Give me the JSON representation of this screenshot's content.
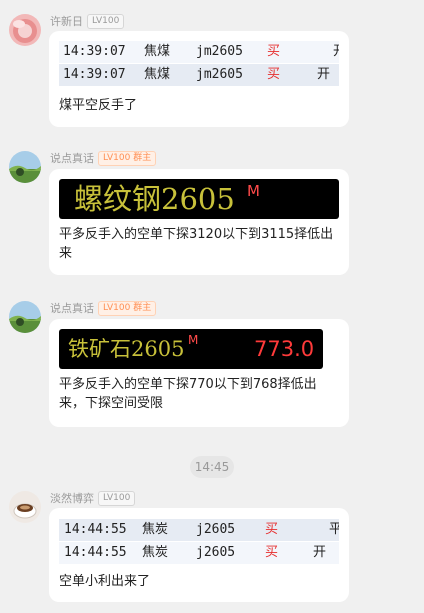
{
  "messages": [
    {
      "sender": "许新日",
      "level": "LV100",
      "table": {
        "rows": [
          {
            "time": "14:39:07",
            "name": "焦煤",
            "code": "jm2605",
            "side": "买",
            "action": "开"
          },
          {
            "time": "14:39:07",
            "name": "焦煤",
            "code": "jm2605",
            "side": "买",
            "action": "开"
          }
        ]
      },
      "text": "煤平空反手了"
    },
    {
      "sender": "说点真话",
      "level": "LV100",
      "role": "群主",
      "quote": {
        "name": "螺纹钢2605",
        "mark": "M"
      },
      "text": "平多反手入的空单下探3120以下到3115择低出来"
    },
    {
      "sender": "说点真话",
      "level": "LV100",
      "role": "群主",
      "quote": {
        "name": "铁矿石2605",
        "mark": "M",
        "price": "773.0"
      },
      "text": "平多反手入的空单下探770以下到768择低出来，下探空间受限"
    },
    {
      "sender": "淡然博弈",
      "level": "LV100",
      "table": {
        "rows": [
          {
            "time": "14:44:55",
            "name": "焦炭",
            "code": "j2605",
            "side": "买",
            "action": "平"
          },
          {
            "time": "14:44:55",
            "name": "焦炭",
            "code": "j2605",
            "side": "买",
            "action": "开"
          }
        ]
      },
      "text": "空单小利出来了"
    }
  ],
  "divider_time": "14:45",
  "colors": {
    "buy": "#e62e2e",
    "quote_text": "#c8c13a",
    "owner_badge": "#ff8f54",
    "row_alt": "#e6ebf3",
    "row_light": "#f3f6fb"
  },
  "icons": [
    "avatar-pink-flower",
    "avatar-landscape",
    "avatar-landscape",
    "avatar-coffee-cup"
  ]
}
